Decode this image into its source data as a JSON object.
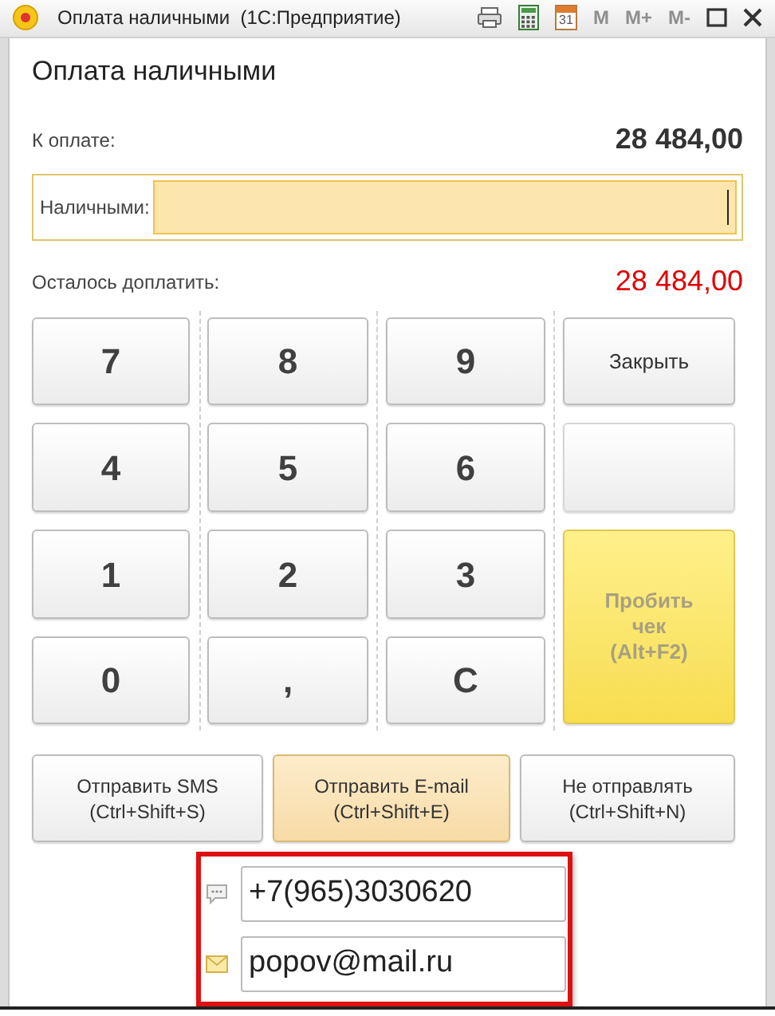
{
  "window": {
    "title": "Оплата наличными  (1С:Предприятие)",
    "tools": [
      {
        "kind": "printer"
      },
      {
        "kind": "calculator"
      },
      {
        "kind": "calendar",
        "label": "31"
      }
    ],
    "memory": [
      {
        "label": "M",
        "disabled": true
      },
      {
        "label": "M+",
        "disabled": true
      },
      {
        "label": "M-",
        "disabled": true
      }
    ]
  },
  "heading": "Оплата наличными",
  "to_pay": {
    "label": "К оплате:",
    "value": "28 484,00"
  },
  "cash": {
    "label": "Наличными:",
    "focused": true
  },
  "remaining": {
    "label": "Осталось доплатить:",
    "value": "28 484,00"
  },
  "keys": [
    {
      "kind": "digit",
      "label": "7"
    },
    {
      "kind": "digit",
      "label": "8"
    },
    {
      "kind": "digit",
      "label": "9"
    },
    {
      "kind": "action",
      "label": "Закрыть"
    },
    {
      "kind": "digit",
      "label": "4"
    },
    {
      "kind": "digit",
      "label": "5"
    },
    {
      "kind": "digit",
      "label": "6"
    },
    {
      "kind": "blank"
    },
    {
      "kind": "digit",
      "label": "1"
    },
    {
      "kind": "digit",
      "label": "2"
    },
    {
      "kind": "digit",
      "label": "3"
    },
    {
      "kind": "primary",
      "label": "Пробить\nчек\n(Alt+F2)",
      "disabled": true
    },
    {
      "kind": "digit",
      "label": "0"
    },
    {
      "kind": "digit",
      "label": ","
    },
    {
      "kind": "digit",
      "label": "C"
    }
  ],
  "send_options": [
    {
      "label": "Отправить SMS\n(Ctrl+Shift+S)",
      "selected": false
    },
    {
      "label": "Отправить E-mail\n(Ctrl+Shift+E)",
      "selected": true
    },
    {
      "label": "Не отправлять\n(Ctrl+Shift+N)",
      "selected": false
    }
  ],
  "contacts": [
    {
      "kind": "phone",
      "value": "+7(965)3030620"
    },
    {
      "kind": "email",
      "value": "popov@mail.ru"
    }
  ]
}
